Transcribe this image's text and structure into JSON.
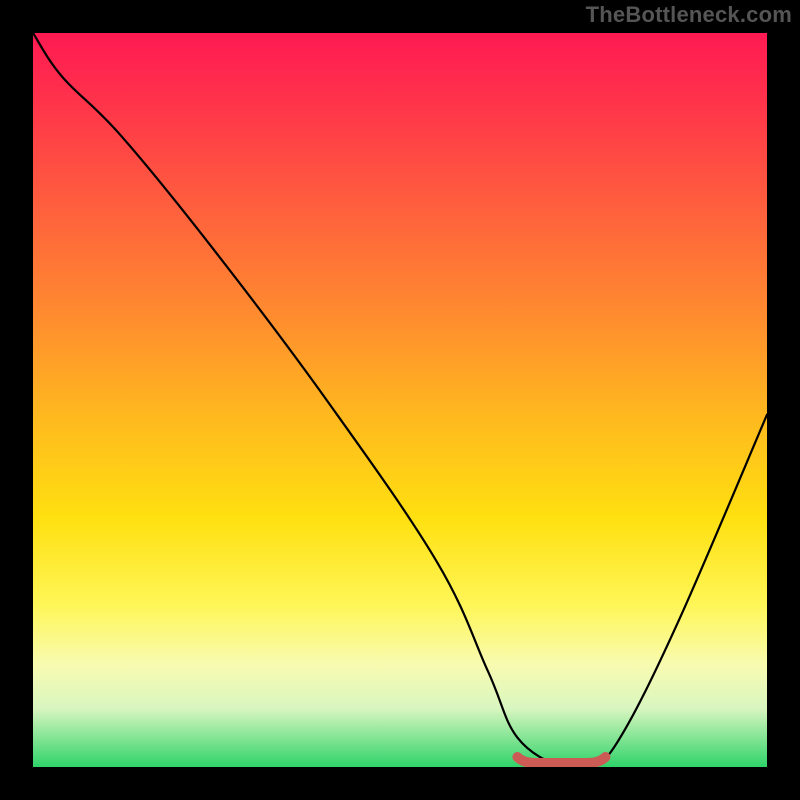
{
  "watermark": "TheBottleneck.com",
  "chart_data": {
    "type": "line",
    "title": "",
    "xlabel": "",
    "ylabel": "",
    "xlim": [
      0,
      100
    ],
    "ylim": [
      0,
      100
    ],
    "series": [
      {
        "name": "bottleneck-curve",
        "x": [
          0,
          4,
          12,
          25,
          40,
          55,
          62,
          66,
          72,
          76,
          80,
          88,
          100
        ],
        "y": [
          100,
          94,
          86,
          70,
          50,
          28,
          13,
          4,
          0,
          0,
          4,
          20,
          48
        ]
      }
    ],
    "optimal_band": {
      "x_start": 66,
      "x_end": 78,
      "y": 0
    },
    "gradient_stops": [
      {
        "pos": 0,
        "color": "#ff1a52"
      },
      {
        "pos": 8,
        "color": "#ff2f4c"
      },
      {
        "pos": 22,
        "color": "#ff5a3f"
      },
      {
        "pos": 38,
        "color": "#ff8a2f"
      },
      {
        "pos": 52,
        "color": "#ffb81f"
      },
      {
        "pos": 66,
        "color": "#ffe010"
      },
      {
        "pos": 78,
        "color": "#fff658"
      },
      {
        "pos": 86,
        "color": "#f8fbb0"
      },
      {
        "pos": 92,
        "color": "#d9f6c0"
      },
      {
        "pos": 100,
        "color": "#2fd36a"
      }
    ],
    "curve_color": "#000000",
    "band_color": "#cc5a55"
  }
}
